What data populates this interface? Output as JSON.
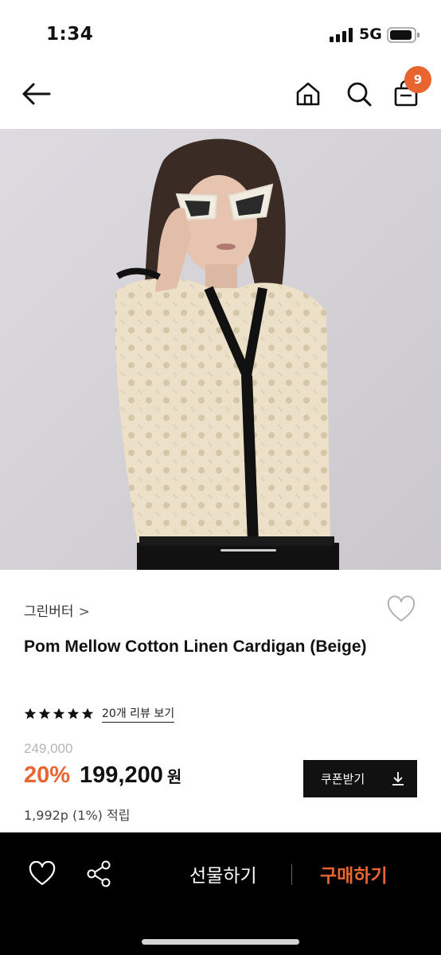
{
  "status_bar": {
    "time": "1:34",
    "network": "5G"
  },
  "header": {
    "cart_count": "9"
  },
  "product": {
    "brand": "그린버터",
    "brand_chevron": ">",
    "title": "Pom Mellow Cotton Linen Cardigan (Beige)",
    "rating_stars": 5,
    "review_link": "20개 리뷰 보기",
    "original_price": "249,000",
    "discount": "20%",
    "sale_price": "199,200",
    "currency": "원",
    "points": "1,992p (1%) 적립"
  },
  "coupon": {
    "label": "쿠폰받기"
  },
  "bottom_bar": {
    "gift_label": "선물하기",
    "buy_label": "구매하기"
  },
  "colors": {
    "accent": "#e8652f",
    "dark": "#111111",
    "bar": "#000000"
  },
  "icons": [
    "back-arrow-icon",
    "home-icon",
    "search-icon",
    "shopping-bag-icon",
    "heart-icon",
    "star-icon",
    "download-icon",
    "share-icon"
  ]
}
